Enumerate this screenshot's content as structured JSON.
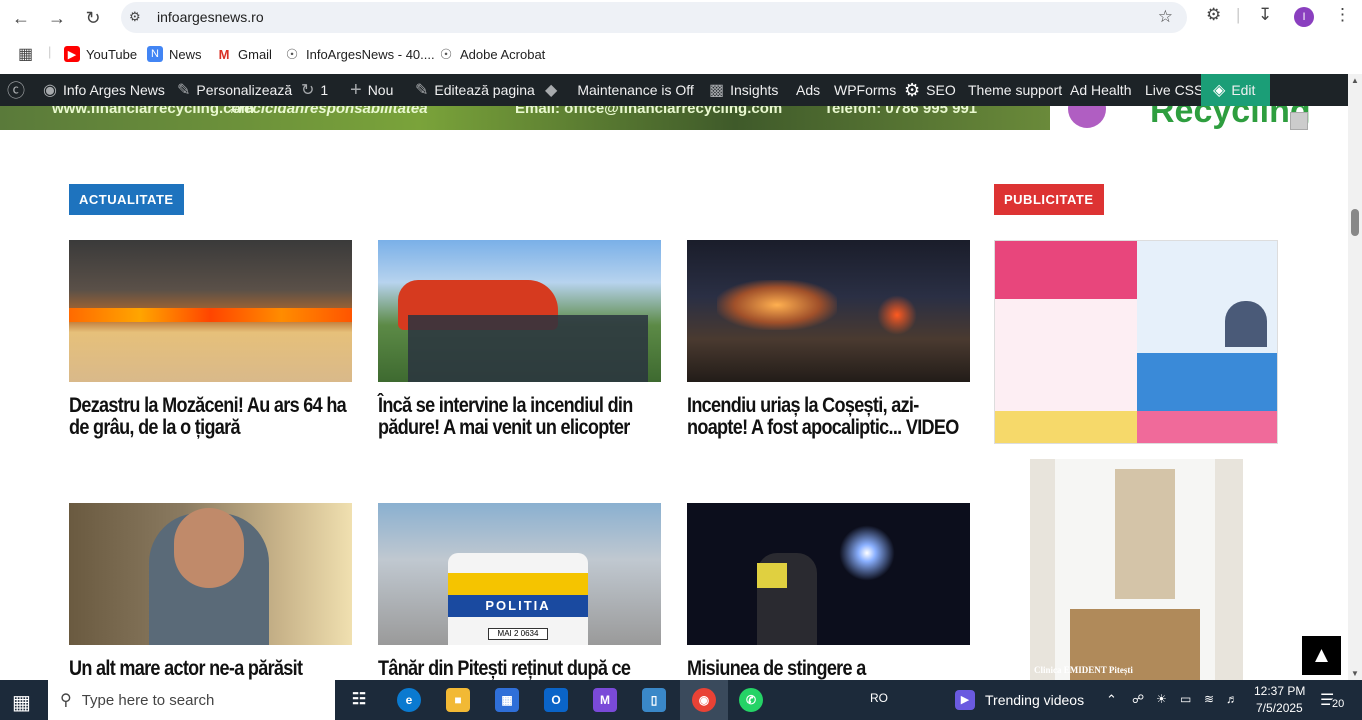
{
  "browser": {
    "url": "infoargesnews.ro",
    "avatar_letter": "I"
  },
  "bookmarks": [
    {
      "label": "YouTube",
      "icon": "youtube-icon"
    },
    {
      "label": "News",
      "icon": "google-news-icon"
    },
    {
      "label": "Gmail",
      "icon": "gmail-icon"
    },
    {
      "label": "InfoArgesNews - 40....",
      "icon": "globe-icon"
    },
    {
      "label": "Adobe Acrobat",
      "icon": "globe-icon"
    }
  ],
  "adminbar": {
    "site": "Info Arges News",
    "customize": "Personalizează",
    "updates_count": "1",
    "new": "Nou",
    "edit_page": "Editează pagina",
    "maintenance": "Maintenance is Off",
    "insights": "Insights",
    "ads": "Ads",
    "wpforms": "WPForms",
    "seo": "SEO",
    "theme_support": "Theme support",
    "ad_health": "Ad Health",
    "live_css": "Live CSS",
    "edit": "Edit"
  },
  "banner": {
    "text1": "www.financiarrecycling.com",
    "text2": "#recicidanresponsabilitatea",
    "email": "Email: office@financiarrecycling.com",
    "phone": "Telefon: 0786 995 991",
    "brand": "Recycling"
  },
  "sections": {
    "news_label": "ACTUALITATE",
    "ads_label": "PUBLICITATE",
    "news_color": "#1e73be",
    "ads_color": "#dd3333"
  },
  "articles": [
    {
      "title": "Dezastru la Mozăceni! Au ars 64 ha de grâu, de la o țigară"
    },
    {
      "title": "Încă se intervine la incendiul din pădure! A mai venit un elicopter"
    },
    {
      "title": "Incendiu uriaș la Coșești, azi-noapte! A fost apocaliptic... VIDEO"
    },
    {
      "title": "Un alt mare actor ne-a părăsit"
    },
    {
      "title": "Tânăr din Pitești reținut după ce"
    },
    {
      "title": "Misiunea de stingere a"
    }
  ],
  "image_text": {
    "police": "POLITIA",
    "plate": "MAI 2 0634",
    "ad2_caption": "Clinica EMIDENT Pitești"
  },
  "taskbar": {
    "search_placeholder": "Type here to search",
    "lang": "RO",
    "trending": "Trending videos",
    "time": "12:37 PM",
    "date": "7/5/2025",
    "notif_count": "20"
  }
}
